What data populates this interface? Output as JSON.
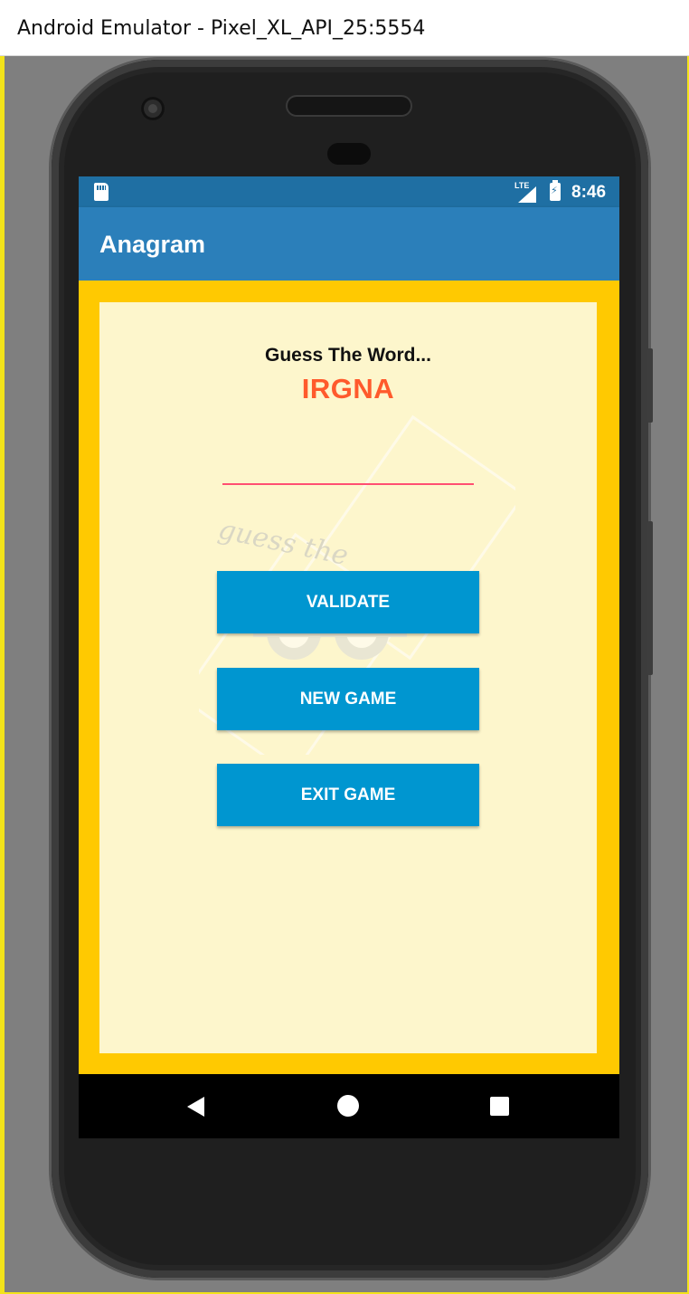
{
  "window": {
    "title": "Android Emulator - Pixel_XL_API_25:5554"
  },
  "status_bar": {
    "time": "8:46",
    "network_label": "LTE",
    "icons": [
      "sd-card-icon",
      "lte-signal-icon",
      "battery-charging-icon"
    ]
  },
  "app_bar": {
    "title": "Anagram"
  },
  "game": {
    "prompt": "Guess The Word...",
    "scrambled_word": "IRGNA",
    "answer_value": "",
    "watermark_text": "guess the"
  },
  "buttons": {
    "validate": "VALIDATE",
    "new_game": "NEW GAME",
    "exit_game": "EXIT GAME"
  },
  "nav_bar": {
    "icons": [
      "back-icon",
      "home-icon",
      "recents-icon"
    ]
  },
  "colors": {
    "status_bar": "#1f6fa3",
    "app_bar": "#2b7fba",
    "content_bg": "#ffc901",
    "card_bg": "#fdf6cc",
    "scrambled_word": "#ff5a2c",
    "input_underline": "#ff4f72",
    "button_bg": "#0096d0"
  }
}
